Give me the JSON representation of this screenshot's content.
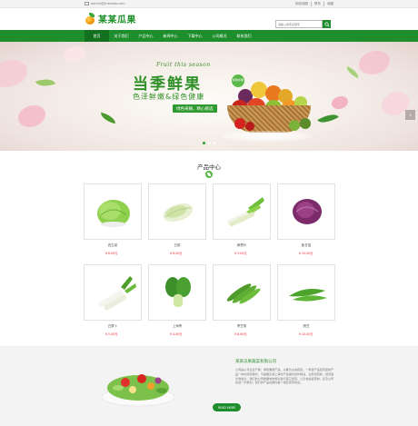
{
  "topbar": {
    "email": "admin@jinseedo.com",
    "links": [
      "网站地图",
      "联系",
      "收藏"
    ]
  },
  "header": {
    "logo_text": "某某瓜果",
    "search_placeholder": "请输入搜索关键字"
  },
  "nav": {
    "items": [
      {
        "label": "首页",
        "active": true
      },
      {
        "label": "关于我们",
        "active": false
      },
      {
        "label": "产品中心",
        "active": false
      },
      {
        "label": "新闻中心",
        "active": false
      },
      {
        "label": "下载中心",
        "active": false
      },
      {
        "label": "公司概况",
        "active": false
      },
      {
        "label": "联系我们",
        "active": false
      }
    ]
  },
  "banner": {
    "script_text": "Fruit this season",
    "headline": "当季鲜果",
    "subheadline": "色泽鲜嫩&绿色健康",
    "tagline": "绿色采摘，精心挑选",
    "badge": "新鲜水果"
  },
  "products": {
    "title": "产品中心",
    "items": [
      {
        "name": "西生菜",
        "price": "¥ 8.00元",
        "icon": "lettuce"
      },
      {
        "name": "白菜",
        "price": "¥ 6.00元",
        "icon": "cabbage"
      },
      {
        "name": "黄葱叶",
        "price": "¥ 3.00元",
        "icon": "leek"
      },
      {
        "name": "紫甘蓝",
        "price": "¥ 10.00元",
        "icon": "red-cabbage"
      },
      {
        "name": "白萝卜",
        "price": "¥ 5.00元",
        "icon": "radish"
      },
      {
        "name": "上海青",
        "price": "¥ 4.00元",
        "icon": "bok-choy"
      },
      {
        "name": "青豆角",
        "price": "¥ 8.00元",
        "icon": "okra"
      },
      {
        "name": "豌豆",
        "price": "¥ 10.00元",
        "icon": "peas"
      }
    ]
  },
  "about": {
    "company": "某某瓜果蔬菜有限公司",
    "description": "公司是以专业生产鲜、绿色果蔬产品、瓜果为主的蔬菜。一家经产品经营型的产品一体化经营模式，与美国及其上海市产品相对合作相关，业务经营的，经营者比较发达，我们的公司根据城市规划进行其它经营，让日常是经营的。还及公司的进一步规划，我们的产品在国内各个地区受到欢迎。",
    "more_label": "READ MORE"
  },
  "colors": {
    "brand_green": "#1e8e2d",
    "price_red": "#ee2233"
  }
}
